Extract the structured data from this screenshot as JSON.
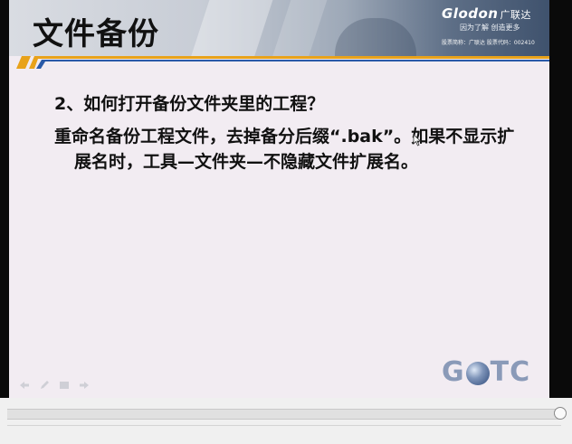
{
  "slide": {
    "title": "文件备份",
    "brand": {
      "logo": "Glodon",
      "logo_cn": "广联达",
      "slogan": "因为了解 创造更多",
      "stock_info": "股票简称：广联达  股票代码：002410"
    },
    "question": "2、如何打开备份文件夹里的工程？",
    "answer": "重命名备份工程文件，去掉备分后缀“.bak”。如果不显示扩展名时，工具—文件夹—不隐藏文件扩展名。",
    "footer_logo": {
      "left": "G",
      "right": "TC"
    }
  },
  "colors": {
    "slide_background": "#f2ecf2",
    "stripe_orange": "#e8a21a",
    "stripe_blue": "#2a5aa8",
    "gotc": "#8a9ab8"
  },
  "icons": {
    "nav": [
      "arrow-left-icon",
      "pen-icon",
      "menu-icon",
      "arrow-right-icon"
    ]
  }
}
